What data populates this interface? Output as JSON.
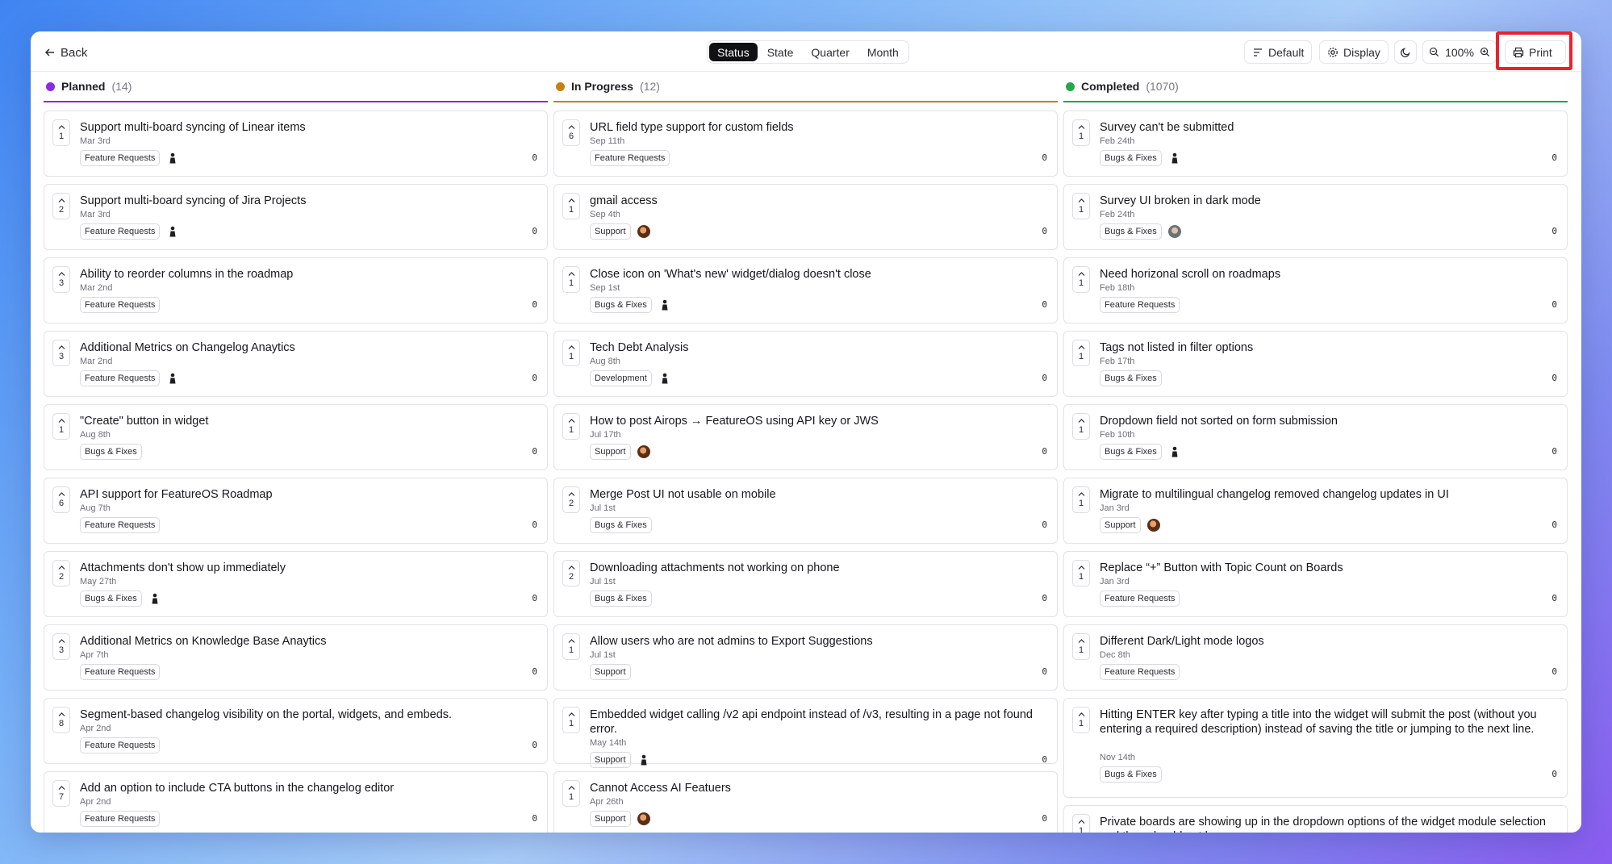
{
  "header": {
    "back_label": "Back",
    "tabs": [
      "Status",
      "State",
      "Quarter",
      "Month"
    ],
    "active_tab": "Status",
    "default_label": "Default",
    "display_label": "Display",
    "zoom": "100%",
    "print_label": "Print"
  },
  "colors": {
    "planned": "#8a2be2",
    "in_progress": "#c48211",
    "completed": "#22a74a",
    "highlight": "#e8222e"
  },
  "columns": [
    {
      "title": "Planned",
      "count": "(14)",
      "cards": [
        {
          "votes": "1",
          "title": "Support multi-board syncing of Linear items",
          "date": "Mar 3rd",
          "tag": "Feature Requests",
          "avatar": "figure",
          "count": "0"
        },
        {
          "votes": "2",
          "title": "Support multi-board syncing of Jira Projects",
          "date": "Mar 3rd",
          "tag": "Feature Requests",
          "avatar": "figure",
          "count": "0"
        },
        {
          "votes": "3",
          "title": "Ability to reorder columns in the roadmap",
          "date": "Mar 2nd",
          "tag": "Feature Requests",
          "avatar": "",
          "count": "0"
        },
        {
          "votes": "3",
          "title": "Additional Metrics on Changelog Anaytics",
          "date": "Mar 2nd",
          "tag": "Feature Requests",
          "avatar": "figure",
          "count": "0"
        },
        {
          "votes": "1",
          "title": "\"Create\" button in widget",
          "date": "Aug 8th",
          "tag": "Bugs & Fixes",
          "avatar": "",
          "count": "0"
        },
        {
          "votes": "6",
          "title": "API support for FeatureOS Roadmap",
          "date": "Aug 7th",
          "tag": "Feature Requests",
          "avatar": "",
          "count": "0"
        },
        {
          "votes": "2",
          "title": "Attachments don't show up immediately",
          "date": "May 27th",
          "tag": "Bugs & Fixes",
          "avatar": "figure",
          "count": "0"
        },
        {
          "votes": "3",
          "title": "Additional Metrics on Knowledge Base Anaytics",
          "date": "Apr 7th",
          "tag": "Feature Requests",
          "avatar": "",
          "count": "0"
        },
        {
          "votes": "8",
          "title": "Segment-based changelog visibility on the portal, widgets, and embeds.",
          "date": "Apr 2nd",
          "tag": "Feature Requests",
          "avatar": "",
          "count": "0"
        },
        {
          "votes": "7",
          "title": "Add an option to include CTA buttons in the changelog editor",
          "date": "Apr 2nd",
          "tag": "Feature Requests",
          "avatar": "",
          "count": "0"
        }
      ]
    },
    {
      "title": "In Progress",
      "count": "(12)",
      "cards": [
        {
          "votes": "6",
          "title": "URL field type support for custom fields",
          "date": "Sep 11th",
          "tag": "Feature Requests",
          "avatar": "",
          "count": "0"
        },
        {
          "votes": "1",
          "title": "gmail access",
          "date": "Sep 4th",
          "tag": "Support",
          "avatar": "photo",
          "count": "0"
        },
        {
          "votes": "1",
          "title": "Close icon on 'What's new' widget/dialog doesn't close",
          "date": "Sep 1st",
          "tag": "Bugs & Fixes",
          "avatar": "figure",
          "count": "0"
        },
        {
          "votes": "1",
          "title": "Tech Debt Analysis",
          "date": "Aug 8th",
          "tag": "Development",
          "avatar": "figure",
          "count": "0"
        },
        {
          "votes": "1",
          "title": "How to post Airops → FeatureOS using API key or JWS",
          "date": "Jul 17th",
          "tag": "Support",
          "avatar": "photo",
          "count": "0"
        },
        {
          "votes": "2",
          "title": "Merge Post UI not usable on mobile",
          "date": "Jul 1st",
          "tag": "Bugs & Fixes",
          "avatar": "",
          "count": "0"
        },
        {
          "votes": "2",
          "title": "Downloading attachments not working on phone",
          "date": "Jul 1st",
          "tag": "Bugs & Fixes",
          "avatar": "",
          "count": "0"
        },
        {
          "votes": "1",
          "title": "Allow users who are not admins to Export Suggestions",
          "date": "Jul 1st",
          "tag": "Support",
          "avatar": "",
          "count": "0"
        },
        {
          "votes": "1",
          "title": "Embedded widget calling /v2 api endpoint instead of /v3, resulting in a page not found error.",
          "date": "May 14th",
          "tag": "Support",
          "avatar": "figure",
          "count": "0"
        },
        {
          "votes": "1",
          "title": "Cannot Access AI Featuers",
          "date": "Apr 26th",
          "tag": "Support",
          "avatar": "photo",
          "count": "0"
        }
      ]
    },
    {
      "title": "Completed",
      "count": "(1070)",
      "cards": [
        {
          "votes": "1",
          "title": "Survey can't be submitted",
          "date": "Feb 24th",
          "tag": "Bugs & Fixes",
          "avatar": "figure",
          "count": "0"
        },
        {
          "votes": "1",
          "title": "Survey UI broken in dark mode",
          "date": "Feb 24th",
          "tag": "Bugs & Fixes",
          "avatar": "photo2",
          "count": "0"
        },
        {
          "votes": "1",
          "title": "Need horizonal scroll on roadmaps",
          "date": "Feb 18th",
          "tag": "Feature Requests",
          "avatar": "",
          "count": "0"
        },
        {
          "votes": "1",
          "title": "Tags not listed in filter options",
          "date": "Feb 17th",
          "tag": "Bugs & Fixes",
          "avatar": "",
          "count": "0"
        },
        {
          "votes": "1",
          "title": "Dropdown field not sorted on form submission",
          "date": "Feb 10th",
          "tag": "Bugs & Fixes",
          "avatar": "figure",
          "count": "0"
        },
        {
          "votes": "1",
          "title": "Migrate to multilingual changelog removed changelog updates in UI",
          "date": "Jan 3rd",
          "tag": "Support",
          "avatar": "photo",
          "count": "0"
        },
        {
          "votes": "1",
          "title": "Replace “+” Button with Topic Count on Boards",
          "date": "Jan 3rd",
          "tag": "Feature Requests",
          "avatar": "",
          "count": "0"
        },
        {
          "votes": "1",
          "title": "Different Dark/Light mode logos",
          "date": "Dec 8th",
          "tag": "Feature Requests",
          "avatar": "",
          "count": "0"
        },
        {
          "votes": "1",
          "title": "Hitting ENTER key after typing a title into the widget will submit the post (without you entering a required description) instead of saving the title or jumping to the next line.",
          "date": "Nov 14th",
          "tag": "Bugs & Fixes",
          "avatar": "",
          "count": "0"
        },
        {
          "votes": "1",
          "title": "Private boards are showing up in the dropdown options of the widget module selection and they should not be",
          "date": "",
          "tag": "",
          "avatar": "",
          "count": ""
        }
      ]
    }
  ]
}
